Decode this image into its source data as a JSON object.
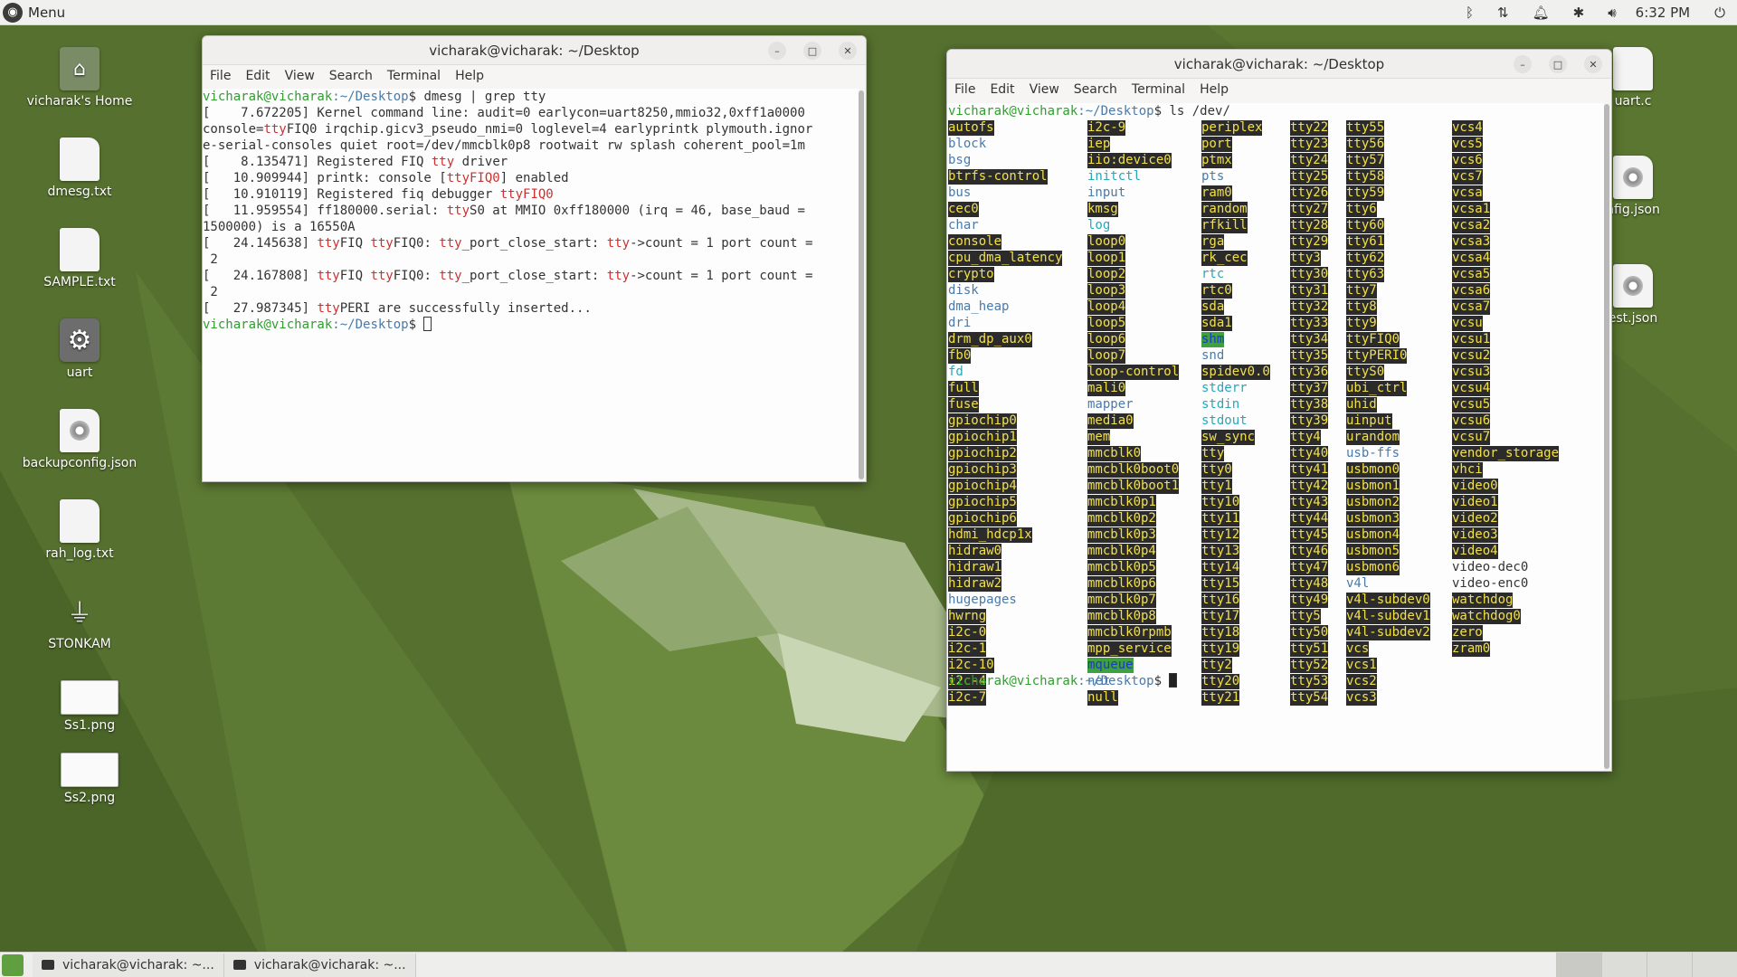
{
  "topbar": {
    "menu_label": "Menu",
    "clock": "6:32 PM"
  },
  "desktop_icons": [
    {
      "label": "vicharak's Home"
    },
    {
      "label": "dmesg.txt"
    },
    {
      "label": "SAMPLE.txt"
    },
    {
      "label": "uart"
    },
    {
      "label": "backupconfig.json"
    },
    {
      "label": "rah_log.txt"
    },
    {
      "label": "STONKAM"
    },
    {
      "label": "Ss1.png"
    },
    {
      "label": "Ss2.png"
    },
    {
      "label": "uart.c"
    },
    {
      "label": "nfig.json"
    },
    {
      "label": "est.json"
    }
  ],
  "window1": {
    "title": "vicharak@vicharak: ~/Desktop",
    "menu": [
      "File",
      "Edit",
      "View",
      "Search",
      "Terminal",
      "Help"
    ],
    "prompt_user": "vicharak@vicharak",
    "prompt_path": ":~/Desktop",
    "prompt_sym": "$",
    "command": " dmesg | grep tty",
    "lines": [
      [
        "[    7.672205] Kernel command line: audit=0 earlycon=uart8250,mmio32,0xff1a0000"
      ],
      [
        "console=",
        "tty",
        "FIQ0 irqchip.gicv3_pseudo_nmi=0 loglevel=4 earlyprintk plymouth.ignor"
      ],
      [
        "e-serial-consoles quiet root=/dev/mmcblk0p8 rootwait rw splash coherent_pool=1m"
      ],
      [
        "[    8.135471] Registered FIQ ",
        "tty",
        " driver"
      ],
      [
        "[   10.909944] printk: console [",
        "ttyFIQ0",
        "] enabled"
      ],
      [
        "[   10.910119] Registered fiq debugger ",
        "ttyFIQ0",
        ""
      ],
      [
        "[   11.959554] ff180000.serial: ",
        "tty",
        "S0 at MMIO 0xff180000 (irq = 46, base_baud ="
      ],
      [
        "1500000) is a 16550A"
      ],
      [
        "[   24.145638] ",
        "tty",
        "FIQ ",
        "tty",
        "FIQ0: ",
        "tty",
        "_port_close_start: ",
        "tty",
        "->count = 1 port count ="
      ],
      [
        " 2"
      ],
      [
        "[   24.167808] ",
        "tty",
        "FIQ ",
        "tty",
        "FIQ0: ",
        "tty",
        "_port_close_start: ",
        "tty",
        "->count = 1 port count ="
      ],
      [
        " 2"
      ],
      [
        "[   27.987345] ",
        "tty",
        "PERI are successfully inserted..."
      ]
    ]
  },
  "window2": {
    "title": "vicharak@vicharak: ~/Desktop",
    "menu": [
      "File",
      "Edit",
      "View",
      "Search",
      "Terminal",
      "Help"
    ],
    "prompt_user": "vicharak@vicharak",
    "prompt_path": ":~/Desktop",
    "prompt_sym": "$",
    "command": " ls /dev/",
    "columns": [
      [
        [
          "autofs",
          "c"
        ],
        [
          "block",
          "d"
        ],
        [
          "bsg",
          "d"
        ],
        [
          "btrfs-control",
          "c"
        ],
        [
          "bus",
          "d"
        ],
        [
          "cec0",
          "c"
        ],
        [
          "char",
          "d"
        ],
        [
          "console",
          "c"
        ],
        [
          "cpu_dma_latency",
          "c"
        ],
        [
          "crypto",
          "c"
        ],
        [
          "disk",
          "d"
        ],
        [
          "dma_heap",
          "d"
        ],
        [
          "dri",
          "d"
        ],
        [
          "drm_dp_aux0",
          "c"
        ],
        [
          "fb0",
          "c"
        ],
        [
          "fd",
          "l"
        ],
        [
          "full",
          "c"
        ],
        [
          "fuse",
          "c"
        ],
        [
          "gpiochip0",
          "c"
        ],
        [
          "gpiochip1",
          "c"
        ],
        [
          "gpiochip2",
          "c"
        ],
        [
          "gpiochip3",
          "c"
        ],
        [
          "gpiochip4",
          "c"
        ],
        [
          "gpiochip5",
          "c"
        ],
        [
          "gpiochip6",
          "c"
        ],
        [
          "hdmi_hdcp1x",
          "c"
        ],
        [
          "hidraw0",
          "c"
        ],
        [
          "hidraw1",
          "c"
        ],
        [
          "hidraw2",
          "c"
        ],
        [
          "hugepages",
          "d"
        ],
        [
          "hwrng",
          "c"
        ],
        [
          "i2c-0",
          "c"
        ],
        [
          "i2c-1",
          "c"
        ],
        [
          "i2c-10",
          "c"
        ],
        [
          "i2c-4",
          "c"
        ],
        [
          "i2c-7",
          "c"
        ]
      ],
      [
        [
          "i2c-9",
          "c"
        ],
        [
          "iep",
          "c"
        ],
        [
          "iio:device0",
          "c"
        ],
        [
          "initctl",
          "l"
        ],
        [
          "input",
          "d"
        ],
        [
          "kmsg",
          "c"
        ],
        [
          "log",
          "l"
        ],
        [
          "loop0",
          "b"
        ],
        [
          "loop1",
          "b"
        ],
        [
          "loop2",
          "b"
        ],
        [
          "loop3",
          "b"
        ],
        [
          "loop4",
          "b"
        ],
        [
          "loop5",
          "b"
        ],
        [
          "loop6",
          "b"
        ],
        [
          "loop7",
          "b"
        ],
        [
          "loop-control",
          "c"
        ],
        [
          "mali0",
          "c"
        ],
        [
          "mapper",
          "d"
        ],
        [
          "media0",
          "c"
        ],
        [
          "mem",
          "c"
        ],
        [
          "mmcblk0",
          "b"
        ],
        [
          "mmcblk0boot0",
          "b"
        ],
        [
          "mmcblk0boot1",
          "b"
        ],
        [
          "mmcblk0p1",
          "b"
        ],
        [
          "mmcblk0p2",
          "b"
        ],
        [
          "mmcblk0p3",
          "b"
        ],
        [
          "mmcblk0p4",
          "b"
        ],
        [
          "mmcblk0p5",
          "b"
        ],
        [
          "mmcblk0p6",
          "b"
        ],
        [
          "mmcblk0p7",
          "b"
        ],
        [
          "mmcblk0p8",
          "b"
        ],
        [
          "mmcblk0rpmb",
          "b"
        ],
        [
          "mpp_service",
          "c"
        ],
        [
          "mqueue",
          "s"
        ],
        [
          "net",
          "d"
        ],
        [
          "null",
          "c"
        ]
      ],
      [
        [
          "periplex",
          "c"
        ],
        [
          "port",
          "c"
        ],
        [
          "ptmx",
          "c"
        ],
        [
          "pts",
          "d"
        ],
        [
          "ram0",
          "b"
        ],
        [
          "random",
          "c"
        ],
        [
          "rfkill",
          "c"
        ],
        [
          "rga",
          "c"
        ],
        [
          "rk_cec",
          "c"
        ],
        [
          "rtc",
          "l"
        ],
        [
          "rtc0",
          "c"
        ],
        [
          "sda",
          "b"
        ],
        [
          "sda1",
          "b"
        ],
        [
          "shm",
          "s"
        ],
        [
          "snd",
          "d"
        ],
        [
          "spidev0.0",
          "c"
        ],
        [
          "stderr",
          "l"
        ],
        [
          "stdin",
          "l"
        ],
        [
          "stdout",
          "l"
        ],
        [
          "sw_sync",
          "c"
        ],
        [
          "tty",
          "c"
        ],
        [
          "tty0",
          "c"
        ],
        [
          "tty1",
          "c"
        ],
        [
          "tty10",
          "c"
        ],
        [
          "tty11",
          "c"
        ],
        [
          "tty12",
          "c"
        ],
        [
          "tty13",
          "c"
        ],
        [
          "tty14",
          "c"
        ],
        [
          "tty15",
          "c"
        ],
        [
          "tty16",
          "c"
        ],
        [
          "tty17",
          "c"
        ],
        [
          "tty18",
          "c"
        ],
        [
          "tty19",
          "c"
        ],
        [
          "tty2",
          "c"
        ],
        [
          "tty20",
          "c"
        ],
        [
          "tty21",
          "c"
        ]
      ],
      [
        [
          "tty22",
          "c"
        ],
        [
          "tty23",
          "c"
        ],
        [
          "tty24",
          "c"
        ],
        [
          "tty25",
          "c"
        ],
        [
          "tty26",
          "c"
        ],
        [
          "tty27",
          "c"
        ],
        [
          "tty28",
          "c"
        ],
        [
          "tty29",
          "c"
        ],
        [
          "tty3",
          "c"
        ],
        [
          "tty30",
          "c"
        ],
        [
          "tty31",
          "c"
        ],
        [
          "tty32",
          "c"
        ],
        [
          "tty33",
          "c"
        ],
        [
          "tty34",
          "c"
        ],
        [
          "tty35",
          "c"
        ],
        [
          "tty36",
          "c"
        ],
        [
          "tty37",
          "c"
        ],
        [
          "tty38",
          "c"
        ],
        [
          "tty39",
          "c"
        ],
        [
          "tty4",
          "c"
        ],
        [
          "tty40",
          "c"
        ],
        [
          "tty41",
          "c"
        ],
        [
          "tty42",
          "c"
        ],
        [
          "tty43",
          "c"
        ],
        [
          "tty44",
          "c"
        ],
        [
          "tty45",
          "c"
        ],
        [
          "tty46",
          "c"
        ],
        [
          "tty47",
          "c"
        ],
        [
          "tty48",
          "c"
        ],
        [
          "tty49",
          "c"
        ],
        [
          "tty5",
          "c"
        ],
        [
          "tty50",
          "c"
        ],
        [
          "tty51",
          "c"
        ],
        [
          "tty52",
          "c"
        ],
        [
          "tty53",
          "c"
        ],
        [
          "tty54",
          "c"
        ]
      ],
      [
        [
          "tty55",
          "c"
        ],
        [
          "tty56",
          "c"
        ],
        [
          "tty57",
          "c"
        ],
        [
          "tty58",
          "c"
        ],
        [
          "tty59",
          "c"
        ],
        [
          "tty6",
          "c"
        ],
        [
          "tty60",
          "c"
        ],
        [
          "tty61",
          "c"
        ],
        [
          "tty62",
          "c"
        ],
        [
          "tty63",
          "c"
        ],
        [
          "tty7",
          "c"
        ],
        [
          "tty8",
          "c"
        ],
        [
          "tty9",
          "c"
        ],
        [
          "ttyFIQ0",
          "c"
        ],
        [
          "ttyPERI0",
          "c"
        ],
        [
          "ttyS0",
          "c"
        ],
        [
          "ubi_ctrl",
          "c"
        ],
        [
          "uhid",
          "c"
        ],
        [
          "uinput",
          "c"
        ],
        [
          "urandom",
          "c"
        ],
        [
          "usb-ffs",
          "d"
        ],
        [
          "usbmon0",
          "c"
        ],
        [
          "usbmon1",
          "c"
        ],
        [
          "usbmon2",
          "c"
        ],
        [
          "usbmon3",
          "c"
        ],
        [
          "usbmon4",
          "c"
        ],
        [
          "usbmon5",
          "c"
        ],
        [
          "usbmon6",
          "c"
        ],
        [
          "v4l",
          "d"
        ],
        [
          "v4l-subdev0",
          "c"
        ],
        [
          "v4l-subdev1",
          "c"
        ],
        [
          "v4l-subdev2",
          "c"
        ],
        [
          "vcs",
          "c"
        ],
        [
          "vcs1",
          "c"
        ],
        [
          "vcs2",
          "c"
        ],
        [
          "vcs3",
          "c"
        ]
      ],
      [
        [
          "vcs4",
          "c"
        ],
        [
          "vcs5",
          "c"
        ],
        [
          "vcs6",
          "c"
        ],
        [
          "vcs7",
          "c"
        ],
        [
          "vcsa",
          "c"
        ],
        [
          "vcsa1",
          "c"
        ],
        [
          "vcsa2",
          "c"
        ],
        [
          "vcsa3",
          "c"
        ],
        [
          "vcsa4",
          "c"
        ],
        [
          "vcsa5",
          "c"
        ],
        [
          "vcsa6",
          "c"
        ],
        [
          "vcsa7",
          "c"
        ],
        [
          "vcsu",
          "c"
        ],
        [
          "vcsu1",
          "c"
        ],
        [
          "vcsu2",
          "c"
        ],
        [
          "vcsu3",
          "c"
        ],
        [
          "vcsu4",
          "c"
        ],
        [
          "vcsu5",
          "c"
        ],
        [
          "vcsu6",
          "c"
        ],
        [
          "vcsu7",
          "c"
        ],
        [
          "vendor_storage",
          "c"
        ],
        [
          "vhci",
          "c"
        ],
        [
          "video0",
          "c"
        ],
        [
          "video1",
          "c"
        ],
        [
          "video2",
          "c"
        ],
        [
          "video3",
          "c"
        ],
        [
          "video4",
          "c"
        ],
        [
          "video-dec0",
          "n"
        ],
        [
          "video-enc0",
          "n"
        ],
        [
          "watchdog",
          "c"
        ],
        [
          "watchdog0",
          "c"
        ],
        [
          "zero",
          "c"
        ],
        [
          "zram0",
          "b"
        ]
      ]
    ]
  },
  "taskbar": {
    "items": [
      {
        "label": "vicharak@vicharak: ~..."
      },
      {
        "label": "vicharak@vicharak: ~..."
      }
    ]
  },
  "colors": {
    "accent": "#5f9f3f",
    "prompt_user": "#2f9e2f",
    "prompt_path": "#4a7aa8",
    "grep_match": "#d02f2f",
    "device_fg": "#f2e04a",
    "device_bg": "#2b2b2b"
  }
}
